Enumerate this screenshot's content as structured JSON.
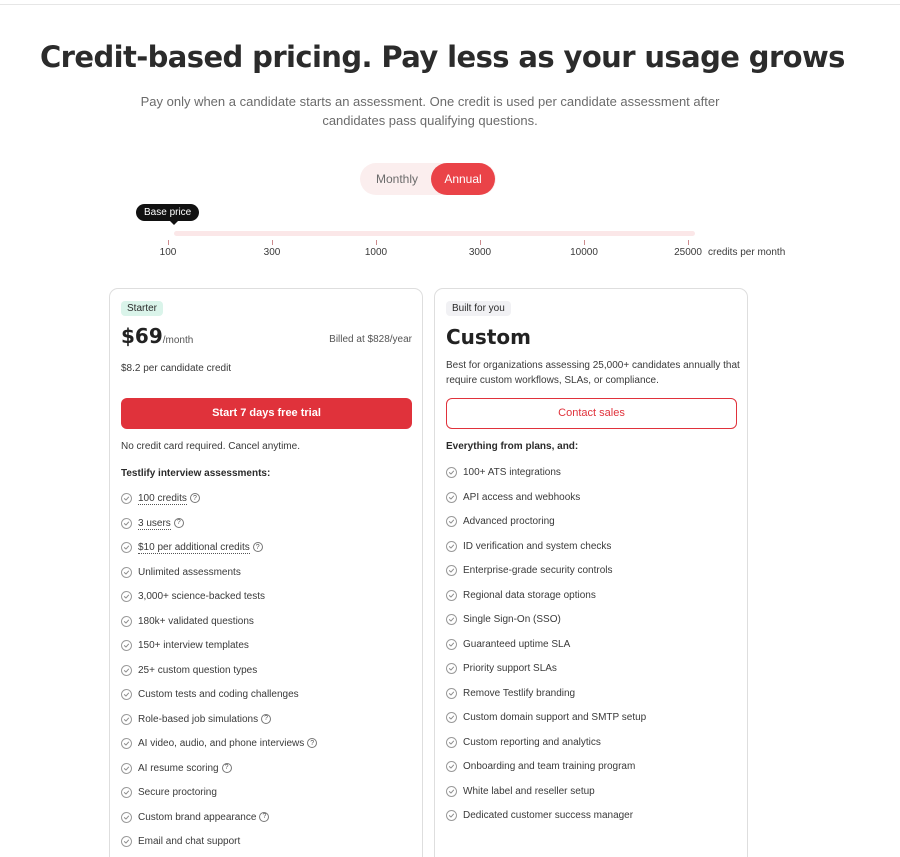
{
  "headline": "Credit-based pricing. Pay less as your usage grows",
  "subtitle": "Pay only when a candidate starts an assessment. One credit is used per candidate assessment after candidates pass qualifying questions.",
  "billing_toggle": {
    "monthly": "Monthly",
    "annual": "Annual",
    "selected": "Annual"
  },
  "slider": {
    "tooltip": "Base price",
    "ticks": [
      "100",
      "300",
      "1000",
      "3000",
      "10000",
      "25000"
    ],
    "unit": "credits per month",
    "selected": "100"
  },
  "starter": {
    "badge": "Starter",
    "price": "$69",
    "period": "/month",
    "billed": "Billed at $828/year",
    "per_credit": "$8.2 per candidate credit",
    "cta": "Start 7 days free trial",
    "note": "No credit card required. Cancel anytime.",
    "section_title": "Testlify interview assessments:",
    "features": [
      {
        "text": "100 credits",
        "help": true,
        "dotted": true
      },
      {
        "text": "3 users",
        "help": true,
        "dotted": true
      },
      {
        "text": "$10 per additional credits",
        "help": true,
        "dotted": true
      },
      {
        "text": "Unlimited assessments",
        "help": false,
        "dotted": false
      },
      {
        "text": "3,000+ science-backed tests",
        "help": false,
        "dotted": false
      },
      {
        "text": "180k+ validated questions",
        "help": false,
        "dotted": false
      },
      {
        "text": "150+ interview templates",
        "help": false,
        "dotted": false
      },
      {
        "text": "25+ custom question types",
        "help": false,
        "dotted": false
      },
      {
        "text": "Custom tests and coding challenges",
        "help": false,
        "dotted": false
      },
      {
        "text": "Role-based job simulations",
        "help": true,
        "dotted": false
      },
      {
        "text": "AI video, audio, and phone interviews",
        "help": true,
        "dotted": false
      },
      {
        "text": "AI resume scoring",
        "help": true,
        "dotted": false
      },
      {
        "text": "Secure proctoring",
        "help": false,
        "dotted": false
      },
      {
        "text": "Custom brand appearance",
        "help": true,
        "dotted": false
      },
      {
        "text": "Email and chat support",
        "help": false,
        "dotted": false
      }
    ]
  },
  "custom": {
    "badge": "Built for you",
    "title": "Custom",
    "description": "Best for organizations assessing 25,000+ candidates annually that require custom workflows, SLAs, or compliance.",
    "cta": "Contact sales",
    "section_title": "Everything from plans, and:",
    "features": [
      "100+ ATS integrations",
      "API access and webhooks",
      "Advanced proctoring",
      "ID verification and system checks",
      "Enterprise-grade security controls",
      "Regional data storage options",
      "Single Sign-On (SSO)",
      "Guaranteed uptime SLA",
      "Priority support SLAs",
      "Remove Testlify branding",
      "Custom domain support and SMTP setup",
      "Custom reporting and analytics",
      "Onboarding and team training program",
      "White label and reseller setup",
      "Dedicated customer success manager"
    ]
  },
  "colors": {
    "accent": "#e0323b",
    "toggle_active": "#ea4348",
    "starter_badge_bg": "#daf4ea"
  }
}
